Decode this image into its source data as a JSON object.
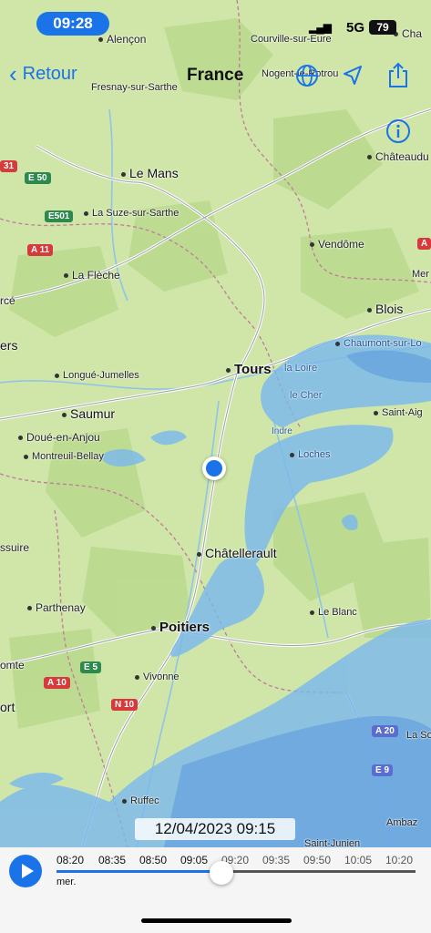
{
  "status_bar": {
    "time": "09:28",
    "network": "5G",
    "battery": "79"
  },
  "nav": {
    "back_label": "Retour",
    "title": "France"
  },
  "map": {
    "labels": {
      "alencon": "Alençon",
      "courville": "Courville-sur-Eure",
      "cha": "Cha",
      "nogent": "Nogent-le-Rotrou",
      "fresnay": "Fresnay-sur-Sarthe",
      "chateaudun": "Châteaudu",
      "lemans": "Le Mans",
      "lasuze": "La Suze-sur-Sarthe",
      "vendome": "Vendôme",
      "lafleche": "La Flèche",
      "mer": "Mer",
      "cerce": "rcé",
      "blois": "Blois",
      "ers": "ers",
      "chaumont": "Chaumont-sur-Lo",
      "tours": "Tours",
      "longue": "Longué-Jumelles",
      "saumur": "Saumur",
      "saintaig": "Saint-Aig",
      "doue": "Doué-en-Anjou",
      "montreuil": "Montreuil-Bellay",
      "loches": "Loches",
      "indre": "Indre",
      "laloire": "la Loire",
      "lecher": "le Cher",
      "ssuire": "ssuire",
      "chatellerault": "Châtellerault",
      "parthenay": "Parthenay",
      "leblanc": "Le Blanc",
      "poitiers": "Poitiers",
      "omte": "omte",
      "vivonne": "Vivonne",
      "ort": "ort",
      "laso": "La So",
      "ruffec": "Ruffec",
      "ambaz": "Ambaz",
      "saintjunien": "Saint-Junien"
    },
    "roads": {
      "e50": "E 50",
      "e501": "E501",
      "a11": "A 11",
      "a31": "31",
      "a10": "A 10",
      "e5": "E 5",
      "n10": "N 10",
      "a20": "A 20",
      "e9": "E 9",
      "a2": "A"
    },
    "timestamp": "12/04/2023 09:15"
  },
  "timeline": {
    "ticks": [
      "08:20",
      "08:35",
      "08:50",
      "09:05",
      "09:20",
      "09:35",
      "09:50",
      "10:05",
      "10:20"
    ],
    "day": "mer.",
    "progress": 0.46
  },
  "colors": {
    "accent": "#1a73e8",
    "land": "#cfe6a8",
    "rain": "#7ab8ee"
  }
}
